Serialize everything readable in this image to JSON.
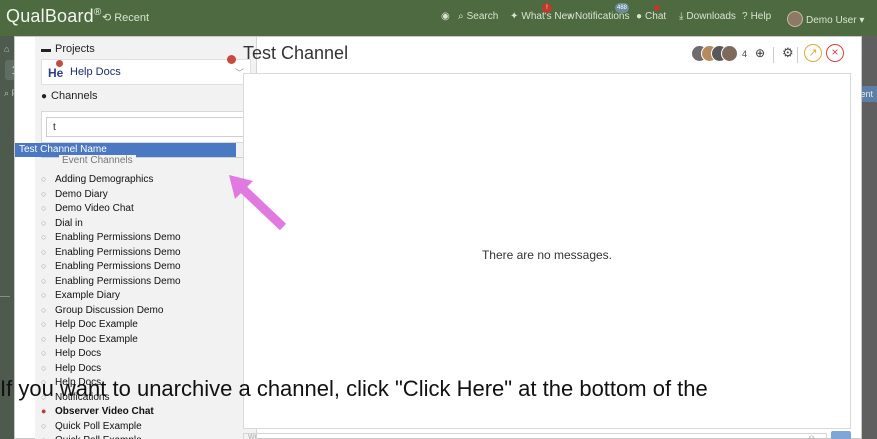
{
  "topbar": {
    "brand": "QualBoard",
    "brand_mark": "®",
    "recent": "Recent",
    "search": "Search",
    "whats_new": "What's New",
    "whats_new_badge": "!",
    "notifications": "Notifications",
    "notifications_badge": "488",
    "chat": "Chat",
    "downloads": "Downloads",
    "help": "Help",
    "user": "Demo User"
  },
  "background": {
    "right_pill": "vent"
  },
  "sidebar": {
    "projects_label": "Projects",
    "project_initials": "He",
    "project_name": "Help Docs",
    "channels_label": "Channels",
    "search_value": "t",
    "suggestion": "Test Channel Name",
    "event_group_label": "Event Channels",
    "channels": [
      {
        "name": "Adding Demographics",
        "bold": false
      },
      {
        "name": "Demo Diary",
        "bold": false
      },
      {
        "name": "Demo Video Chat",
        "bold": false
      },
      {
        "name": "Dial in",
        "bold": false
      },
      {
        "name": "Enabling Permissions Demo",
        "bold": false
      },
      {
        "name": "Enabling Permissions Demo",
        "bold": false
      },
      {
        "name": "Enabling Permissions Demo",
        "bold": false
      },
      {
        "name": "Enabling Permissions Demo",
        "bold": false
      },
      {
        "name": "Example Diary",
        "bold": false
      },
      {
        "name": "Group Discussion Demo",
        "bold": false
      },
      {
        "name": "Help Doc Example",
        "bold": false
      },
      {
        "name": "Help Doc Example",
        "bold": false
      },
      {
        "name": "Help Docs",
        "bold": false
      },
      {
        "name": "Help Docs",
        "bold": false
      },
      {
        "name": "Help Docs",
        "bold": false
      },
      {
        "name": "Notifications",
        "bold": false
      },
      {
        "name": "Observer Video Chat",
        "bold": true
      },
      {
        "name": "Quick Poll Example",
        "bold": false
      },
      {
        "name": "Quick Poll Example",
        "bold": false
      }
    ]
  },
  "main": {
    "title": "Test Channel",
    "member_count": "4",
    "empty_message": "There are no messages.",
    "compose_placeholder": "Wr"
  },
  "caption": "If you want to unarchive a channel, click \"Click Here\" at the bottom of the",
  "colors": {
    "topbar": "#4d6a40",
    "highlight": "#4a78c2",
    "arrow": "#e07ae0",
    "close": "#d9443a",
    "compass": "#e0a93a"
  }
}
